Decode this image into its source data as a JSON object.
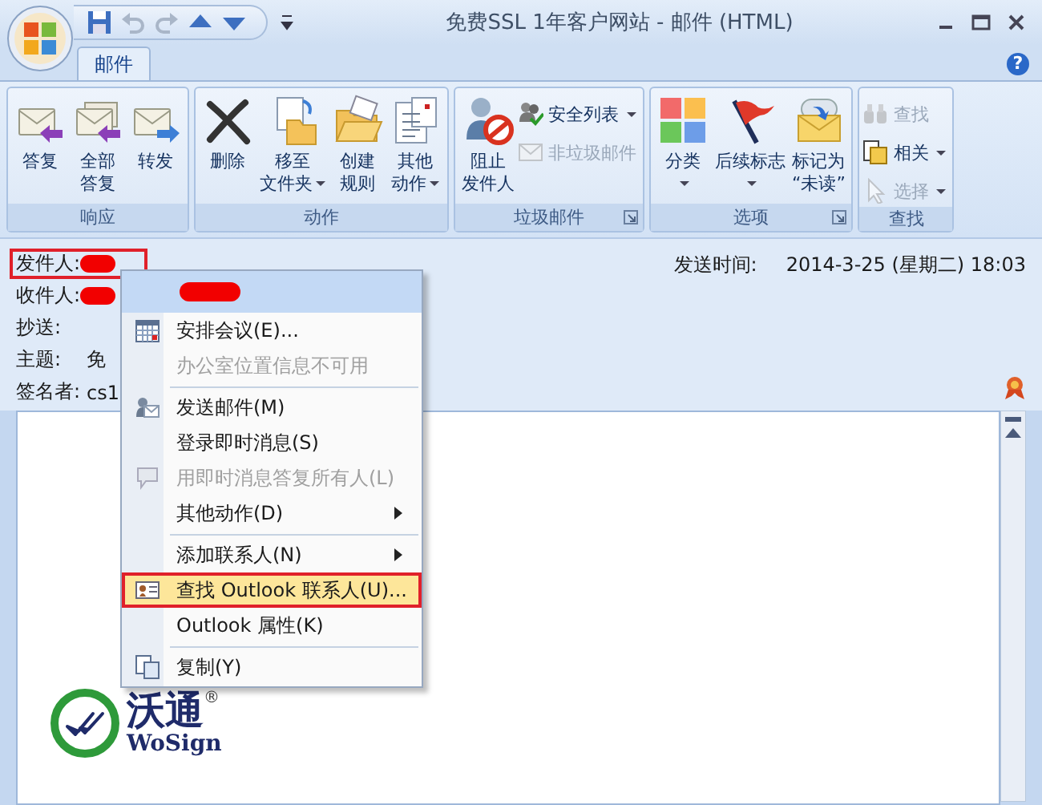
{
  "window": {
    "title": "免费SSL 1年客户网站 - 邮件 (HTML)"
  },
  "quick_access": [
    {
      "disabled": false
    },
    {
      "disabled": true
    },
    {
      "disabled": true
    },
    {
      "disabled": false
    },
    {
      "disabled": false
    }
  ],
  "tabs": [
    {
      "label": "邮件",
      "selected": true
    }
  ],
  "help": "?",
  "ribbon": {
    "groups": [
      {
        "label": "响应",
        "launcher": false,
        "buttons": [
          {
            "kind": "large",
            "label": "答复",
            "dropdown": false,
            "disabled": false
          },
          {
            "kind": "large",
            "label": "全部",
            "label_2": "答复",
            "dropdown": false,
            "disabled": false
          },
          {
            "kind": "large",
            "label": "转发",
            "dropdown": false,
            "disabled": false
          }
        ]
      },
      {
        "label": "动作",
        "launcher": false,
        "buttons": [
          {
            "kind": "large",
            "label": "删除",
            "dropdown": false,
            "disabled": false
          },
          {
            "kind": "large",
            "label": "移至",
            "label_2": "文件夹",
            "dropdown": true,
            "disabled": false
          },
          {
            "kind": "large",
            "label": "创建",
            "label_2": "规则",
            "dropdown": false,
            "disabled": false
          },
          {
            "kind": "large",
            "label": "其他",
            "label_2": "动作",
            "dropdown": true,
            "disabled": false
          }
        ]
      },
      {
        "label": "垃圾邮件",
        "launcher": true,
        "buttons": [
          {
            "kind": "large",
            "label": "阻止",
            "label_2": "发件人",
            "dropdown": false,
            "disabled": false
          },
          {
            "kind": "small",
            "label": "安全列表",
            "dropdown": true,
            "disabled": false
          },
          {
            "kind": "small",
            "label": "非垃圾邮件",
            "dropdown": false,
            "disabled": true
          }
        ]
      },
      {
        "label": "选项",
        "launcher": true,
        "buttons": [
          {
            "kind": "large",
            "label": "分类",
            "dropdown": true,
            "disabled": false
          },
          {
            "kind": "large",
            "label": "后续标志",
            "dropdown": true,
            "disabled": false
          },
          {
            "kind": "large",
            "label": "标记为",
            "label_2": "“未读”",
            "dropdown": false,
            "disabled": false
          }
        ]
      },
      {
        "label": "查找",
        "launcher": false,
        "buttons": [
          {
            "kind": "small",
            "label": "查找",
            "dropdown": false,
            "disabled": true
          },
          {
            "kind": "small",
            "label": "相关",
            "dropdown": true,
            "disabled": false
          },
          {
            "kind": "small",
            "label": "选择",
            "dropdown": true,
            "disabled": true
          }
        ]
      }
    ]
  },
  "header": {
    "fields": [
      {
        "label": "发件人:",
        "redacted": true,
        "outlined": true
      },
      {
        "label": "收件人:",
        "redacted": true,
        "outlined": false
      },
      {
        "label": "抄送:",
        "redacted": false,
        "outlined": false
      },
      {
        "label": "主题:",
        "value": "免",
        "redacted": false,
        "outlined": false
      },
      {
        "label": "签名者:",
        "value": "cs1",
        "redacted": false,
        "outlined": false
      }
    ],
    "sent": {
      "label": "发送时间:",
      "value": "2014-3-25 (星期二) 18:03"
    }
  },
  "context_menu": {
    "items": [
      {
        "kind": "contact",
        "redacted": true
      },
      {
        "kind": "item",
        "label": "安排会议(E)...",
        "disabled": false,
        "submenu": false,
        "selected": false,
        "outlined": false,
        "separator_before": false
      },
      {
        "kind": "item",
        "label": "办公室位置信息不可用",
        "disabled": true,
        "submenu": false,
        "selected": false,
        "outlined": false,
        "separator_before": false
      },
      {
        "kind": "item",
        "label": "发送邮件(M)",
        "disabled": false,
        "submenu": false,
        "selected": false,
        "outlined": false,
        "separator_before": true
      },
      {
        "kind": "item",
        "label": "登录即时消息(S)",
        "disabled": false,
        "submenu": false,
        "selected": false,
        "outlined": false,
        "separator_before": false
      },
      {
        "kind": "item",
        "label": "用即时消息答复所有人(L)",
        "disabled": true,
        "submenu": false,
        "selected": false,
        "outlined": false,
        "separator_before": false
      },
      {
        "kind": "item",
        "label": "其他动作(D)",
        "disabled": false,
        "submenu": true,
        "selected": false,
        "outlined": false,
        "separator_before": false
      },
      {
        "kind": "item",
        "label": "添加联系人(N)",
        "disabled": false,
        "submenu": true,
        "selected": false,
        "outlined": false,
        "separator_before": true
      },
      {
        "kind": "item",
        "label": "查找 Outlook 联系人(U)...",
        "disabled": false,
        "submenu": false,
        "selected": true,
        "outlined": true,
        "separator_before": false
      },
      {
        "kind": "item",
        "label": "Outlook 属性(K)",
        "disabled": false,
        "submenu": false,
        "selected": false,
        "outlined": false,
        "separator_before": false
      },
      {
        "kind": "item",
        "label": "复制(Y)",
        "disabled": false,
        "submenu": false,
        "selected": false,
        "outlined": false,
        "separator_before": true
      }
    ]
  },
  "logo": {
    "name": "沃通",
    "mark": "®",
    "wordmark": "WoSign"
  }
}
